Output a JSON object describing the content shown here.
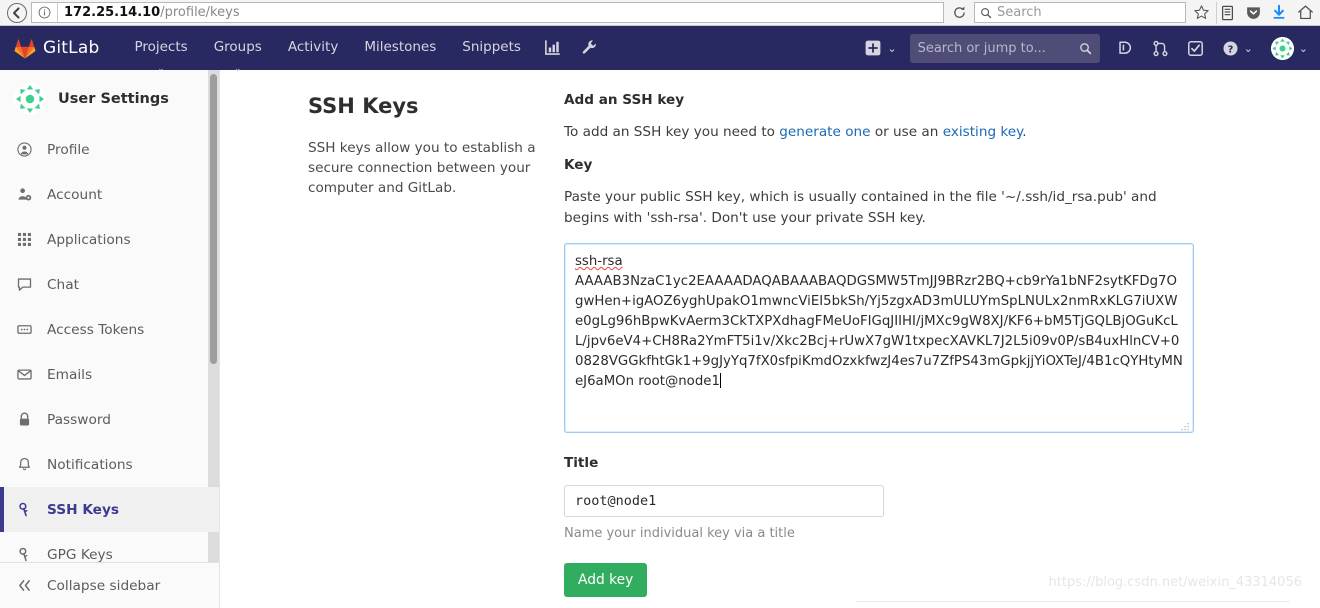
{
  "browser": {
    "back_icon": "back-arrow-icon",
    "info_icon": "info-circle-icon",
    "url_host": "172.25.14.10",
    "url_path": "/profile/keys",
    "reload_icon": "reload-icon",
    "search_placeholder": "Search",
    "search_icon": "search-icon",
    "toolbar_icons": [
      "star-icon",
      "library-icon",
      "pocket-icon",
      "download-icon",
      "home-icon"
    ]
  },
  "navbar": {
    "brand": "GitLab",
    "brand_icon": "gitlab-tanuki-icon",
    "links": [
      {
        "label": "Projects",
        "caret": "⌄"
      },
      {
        "label": "Groups",
        "caret": "⌄"
      },
      {
        "label": "Activity",
        "caret": ""
      },
      {
        "label": "Milestones",
        "caret": ""
      },
      {
        "label": "Snippets",
        "caret": ""
      }
    ],
    "icon_links": [
      "chart-icon",
      "wrench-icon"
    ],
    "plus_icon": "plus-square-icon",
    "plus_caret": "⌄",
    "search_placeholder": "Search or jump to...",
    "search_icon": "search-icon",
    "right_icons": [
      "issues-icon",
      "merge-requests-icon",
      "todos-icon"
    ],
    "help_icon": "question-circle-icon",
    "help_caret": "⌄",
    "avatar": "user-avatar",
    "avatar_caret": "⌄"
  },
  "sidebar": {
    "avatar": "user-avatar",
    "title": "User Settings",
    "items": [
      {
        "label": "Profile",
        "icon": "user-circle-icon",
        "active": false
      },
      {
        "label": "Account",
        "icon": "account-gear-icon",
        "active": false
      },
      {
        "label": "Applications",
        "icon": "grid-apps-icon",
        "active": false
      },
      {
        "label": "Chat",
        "icon": "chat-bubble-icon",
        "active": false
      },
      {
        "label": "Access Tokens",
        "icon": "token-card-icon",
        "active": false
      },
      {
        "label": "Emails",
        "icon": "envelope-icon",
        "active": false
      },
      {
        "label": "Password",
        "icon": "lock-icon",
        "active": false
      },
      {
        "label": "Notifications",
        "icon": "bell-icon",
        "active": false
      },
      {
        "label": "SSH Keys",
        "icon": "key-icon",
        "active": true
      },
      {
        "label": "GPG Keys",
        "icon": "gpg-key-icon",
        "active": false
      }
    ],
    "collapse": {
      "label": "Collapse sidebar",
      "icon": "double-chevron-left-icon"
    }
  },
  "main": {
    "page_title": "SSH Keys",
    "page_description": "SSH keys allow you to establish a secure connection between your computer and GitLab.",
    "form": {
      "heading": "Add an SSH key",
      "intro_pre": "To add an SSH key you need to ",
      "intro_link1": "generate one",
      "intro_mid": " or use an ",
      "intro_link2": "existing key",
      "intro_post": ".",
      "key_label": "Key",
      "key_help": "Paste your public SSH key, which is usually contained in the file '~/.ssh/id_rsa.pub' and begins with 'ssh-rsa'. Don't use your private SSH key.",
      "key_value_head": "ssh-rsa",
      "key_value_body": "AAAAB3NzaC1yc2EAAAADAQABAAABAQDGSMW5TmJJ9BRzr2BQ+cb9rYa1bNF2sytKFDg7OgwHen+igAOZ6yghUpakO1mwncViEI5bkSh/Yj5zgxAD3mULUYmSpLNULx2nmRxKLG7iUXWe0gLg96hBpwKvAerm3CkTXPXdhagFMeUoFIGqJIIHI/jMXc9gW8XJ/KF6+bM5TjGQLBjOGuKcLL/jpv6eV4+CH8Ra2YmFT5i1v/Xkc2Bcj+rUwX7gW1txpecXAVKL7J2L5i09v0P/sB4uxHlnCV+00828VGGkfhtGk1+9gJyYq7fX0sfpiKmdOzxkfwzJ4es7u7ZfPS43mGpkjjYiOXTeJ/4B1cQYHtyMNeJ6aMOn root@node1",
      "key_placeholder": "",
      "title_label": "Title",
      "title_value": "root@node1",
      "title_placeholder": "",
      "title_help": "Name your individual key via a title",
      "submit_label": "Add key"
    },
    "watermark": "https://blog.csdn.net/weixin_43314056"
  },
  "colors": {
    "navbar_bg": "#292961",
    "accent_green": "#31ad60",
    "link_blue": "#1b69b6",
    "active_purple": "#3d3b8e",
    "focus_border": "#9ecaf5"
  }
}
